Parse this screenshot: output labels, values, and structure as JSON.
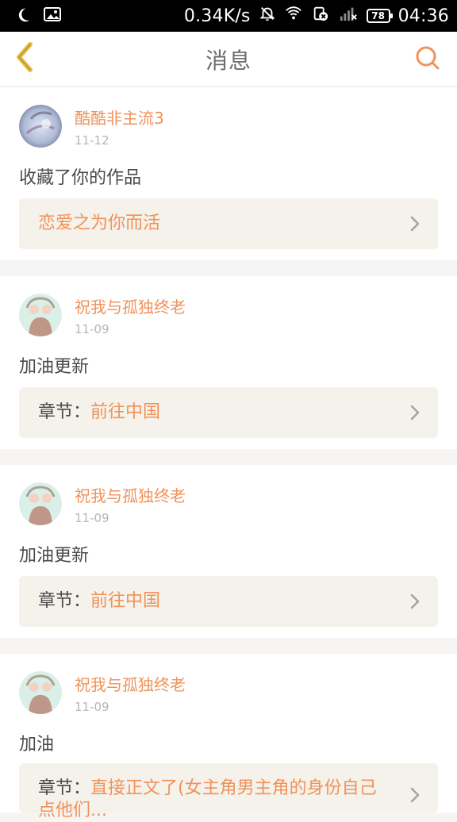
{
  "status_bar": {
    "speed": "0.34K/s",
    "battery": "78",
    "time": "04:36",
    "icons": [
      "moon-icon",
      "image-icon",
      "notification-off-icon",
      "wifi-icon",
      "sim-icon",
      "signal-icon",
      "battery-icon"
    ]
  },
  "header": {
    "title": "消息",
    "back_icon": "chevron-left-icon",
    "search_icon": "search-icon"
  },
  "colors": {
    "accent": "#f0925a",
    "back_accent": "#f1c33b",
    "page_bg": "#f7f4f4",
    "card_bg": "#ffffff",
    "box_bg": "#f4f2ea",
    "text": "#4a4a4a",
    "muted": "#b6b6b6"
  },
  "messages": [
    {
      "username": "酷酷非主流3",
      "date": "11-12",
      "action": "收藏了你的作品",
      "box_prefix": "",
      "box_link": "恋爱之为你而活"
    },
    {
      "username": "祝我与孤独终老",
      "date": "11-09",
      "action": "加油更新",
      "box_prefix": "章节：",
      "box_link": "前往中国"
    },
    {
      "username": "祝我与孤独终老",
      "date": "11-09",
      "action": "加油更新",
      "box_prefix": "章节：",
      "box_link": "前往中国"
    },
    {
      "username": "祝我与孤独终老",
      "date": "11-09",
      "action": "加油",
      "box_prefix": "章节：",
      "box_link": "直接正文了(女主角男主角的身份自己点他们..."
    }
  ]
}
